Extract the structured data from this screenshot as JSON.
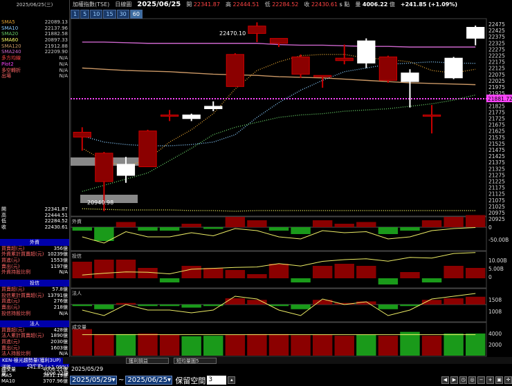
{
  "left": {
    "date": "2025/06/25(三)",
    "indicators": [
      {
        "label": "SMA5",
        "value": "22089.13",
        "color": "#e0a030"
      },
      {
        "label": "SMA10",
        "value": "22137.96",
        "color": "#8cf"
      },
      {
        "label": "SMA20",
        "value": "21882.58",
        "color": "#6c6"
      },
      {
        "label": "SMA60",
        "value": "20897.33",
        "color": "#ff6"
      },
      {
        "label": "SMA120",
        "value": "21912.88",
        "color": "#c96"
      },
      {
        "label": "SMA240",
        "value": "22209.90",
        "color": "#c6c"
      },
      {
        "label": "多方均線",
        "value": "N/A",
        "color": "#f44"
      },
      {
        "label": "Plot2",
        "value": "N/A",
        "color": "#f4f"
      },
      {
        "label": "多空轉折",
        "value": "N/A",
        "color": "#f66"
      },
      {
        "label": "出場",
        "value": "N/A",
        "color": "#f66"
      }
    ],
    "ohlc": [
      {
        "label": "開",
        "value": "22341.87"
      },
      {
        "label": "高",
        "value": "22444.51"
      },
      {
        "label": "低",
        "value": "22284.52"
      },
      {
        "label": "收",
        "value": "22430.61"
      }
    ],
    "foreign": {
      "title": "外資",
      "rows": [
        {
          "label": "買賣超(元)",
          "value": "356億"
        },
        {
          "label": "外資累計買賣超(元)",
          "value": "10239億"
        },
        {
          "label": "買進(元)",
          "value": "1553億"
        },
        {
          "label": "賣出(元)",
          "value": "1197億"
        },
        {
          "label": "外資持股比例",
          "value": "N/A"
        }
      ]
    },
    "trust": {
      "title": "投信",
      "rows": [
        {
          "label": "買賣超(元)",
          "value": "57.8億"
        },
        {
          "label": "投信累計買賣超(元)",
          "value": "13791億"
        },
        {
          "label": "買進(元)",
          "value": "276億"
        },
        {
          "label": "賣出(元)",
          "value": "218億"
        },
        {
          "label": "投信持股比例",
          "value": "N/A"
        }
      ]
    },
    "inst": {
      "title": "法人",
      "rows": [
        {
          "label": "買賣超(元)",
          "value": "428億"
        },
        {
          "label": "法人累計買賣超(元)",
          "value": "1890億"
        },
        {
          "label": "買進(元)",
          "value": "2030億"
        },
        {
          "label": "賣出(元)",
          "value": "1603億"
        },
        {
          "label": "法人持股比例",
          "value": "N/A"
        }
      ]
    },
    "volume": {
      "title": "成交量",
      "rows": [
        {
          "label": "成交量",
          "value": "4006.22億"
        },
        {
          "label": "MA5",
          "value": "3831.19億"
        },
        {
          "label": "MA10",
          "value": "3707.96億"
        }
      ]
    },
    "bottom": [
      {
        "label": "漲跌",
        "value": "241.85 (+1.09%)"
      },
      {
        "label": "量",
        "value": "4006.22億"
      }
    ]
  },
  "topbar": {
    "name": "加權指數(TSE)",
    "period": "日線圖",
    "date": "2025/06/25",
    "open_l": "開",
    "open": "22341.87",
    "high_l": "高",
    "high": "22444.51",
    "low_l": "低",
    "low": "22284.52",
    "close_l": "收",
    "close": "22430.61",
    "flag": "s",
    "flag2": "點",
    "vol_l": "量",
    "vol": "4006.22",
    "unit": "億",
    "change": "+241.85 (+1.09%)"
  },
  "periods": [
    "1",
    "5",
    "10",
    "15",
    "30",
    "60"
  ],
  "chart_data": {
    "type": "candlestick",
    "candles": [
      {
        "o": 21540,
        "h": 21620,
        "l": 21430,
        "c": 21580
      },
      {
        "o": 21180,
        "h": 21420,
        "l": 20940,
        "c": 21410
      },
      {
        "o": 21320,
        "h": 21380,
        "l": 21170,
        "c": 21230
      },
      {
        "o": 21300,
        "h": 21600,
        "l": 21300,
        "c": 21590
      },
      {
        "o": 21715,
        "h": 21760,
        "l": 21670,
        "c": 21720
      },
      {
        "o": 21720,
        "h": 21730,
        "l": 21670,
        "c": 21690
      },
      {
        "o": 21790,
        "h": 21830,
        "l": 21750,
        "c": 21770
      },
      {
        "o": 21950,
        "h": 22220,
        "l": 21950,
        "c": 22210
      },
      {
        "o": 22380,
        "h": 22470,
        "l": 22310,
        "c": 22440
      },
      {
        "o": 22300,
        "h": 22340,
        "l": 22270,
        "c": 22340
      },
      {
        "o": 22050,
        "h": 22210,
        "l": 22020,
        "c": 22190
      },
      {
        "o": 22040,
        "h": 22040,
        "l": 21940,
        "c": 22040
      },
      {
        "o": 22160,
        "h": 22290,
        "l": 22130,
        "c": 22180
      },
      {
        "o": 22320,
        "h": 22340,
        "l": 22100,
        "c": 22140
      },
      {
        "o": 22000,
        "h": 22200,
        "l": 21980,
        "c": 22190
      },
      {
        "o": 22060,
        "h": 22090,
        "l": 21780,
        "c": 21990
      },
      {
        "o": 21710,
        "h": 21800,
        "l": 21570,
        "c": 21720
      },
      {
        "o": 22180,
        "h": 22190,
        "l": 22010,
        "c": 22020
      },
      {
        "o": 22430,
        "h": 22444,
        "l": 22284,
        "c": 22341
      }
    ],
    "price_labels": [
      "22475",
      "22425",
      "22375",
      "22325",
      "22275",
      "22225",
      "22175",
      "22125",
      "22075",
      "22025",
      "21975",
      "21925",
      "21875",
      "21825",
      "21775",
      "21725",
      "21675",
      "21625",
      "21575",
      "21525",
      "21475",
      "21425",
      "21375",
      "21325",
      "21275",
      "21225",
      "21175",
      "21125",
      "21075",
      "21025",
      "20975",
      "20925"
    ],
    "hline_value": "21881.72",
    "annot_high": "22470.10",
    "annot_low": "20940.98",
    "foreign_labels": [
      "0",
      "-50.00B"
    ],
    "foreign": [
      -10,
      -40,
      15,
      -10,
      -10,
      10,
      -5,
      30,
      20,
      -10,
      -20,
      20,
      10,
      15,
      -20,
      -10,
      20,
      30,
      35
    ],
    "trust_labels": [
      "10.00B",
      "5.00B",
      "0"
    ],
    "trust": [
      8,
      9,
      9,
      5,
      -2,
      6,
      5,
      4,
      2,
      7,
      -2,
      6,
      7,
      6,
      -3,
      3,
      -2,
      6,
      5
    ],
    "inst_labels": [
      "1508",
      "1008"
    ],
    "inst": [
      -5,
      -15,
      5,
      -5,
      -5,
      -10,
      -5,
      20,
      15,
      -5,
      -15,
      15,
      5,
      10,
      -15,
      -5,
      15,
      20,
      25
    ],
    "vol_labels": [
      "4000",
      "2000"
    ],
    "volume": [
      4800,
      3900,
      3900,
      4000,
      3800,
      3500,
      3600,
      3800,
      3900,
      3900,
      3700,
      3800,
      3600,
      3800,
      3600,
      4300,
      3600,
      4000,
      4000
    ]
  },
  "tabs": {
    "main": "KEN-極光趨勢量(獲利3UP)",
    "t2": "獲利損益",
    "t3": "短均量圖5"
  },
  "dates": {
    "current": "2025/05/29",
    "from": "2025/05/29",
    "sep": "~",
    "to": "2025/06/25",
    "keep": "保留空間",
    "keep_val": "3"
  }
}
